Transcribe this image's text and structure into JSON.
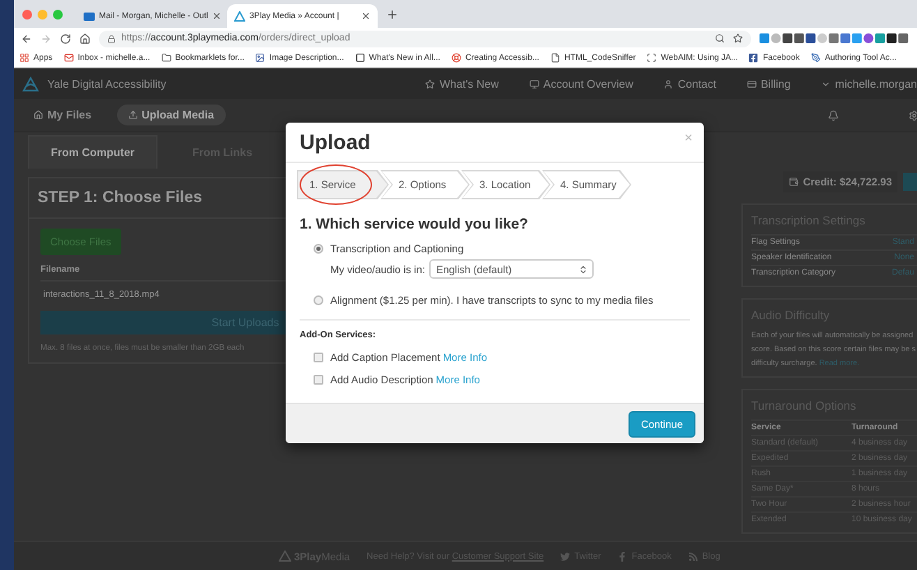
{
  "browser": {
    "tabs": [
      {
        "title": "Mail - Morgan, Michelle - Outl",
        "kind": "mail",
        "selected": false
      },
      {
        "title": "3Play Media » Account |",
        "kind": "logo",
        "selected": true
      }
    ],
    "url": {
      "scheme": "https://",
      "host": "account.3playmedia.com",
      "path": "/orders/direct_upload"
    },
    "bookmarks": [
      {
        "label": "Apps",
        "kind": "apps"
      },
      {
        "label": "Inbox - michelle.a...",
        "kind": "mail"
      },
      {
        "label": "Bookmarklets for...",
        "kind": "folder"
      },
      {
        "label": "Image Description...",
        "kind": "image"
      },
      {
        "label": "What's New in All...",
        "kind": "square"
      },
      {
        "label": "Creating Accessib...",
        "kind": "ring"
      },
      {
        "label": "HTML_CodeSniffer",
        "kind": "page"
      },
      {
        "label": "WebAIM: Using JA...",
        "kind": "scan"
      },
      {
        "label": "Facebook",
        "kind": "facebook"
      },
      {
        "label": "Authoring Tool Ac...",
        "kind": "pen"
      }
    ]
  },
  "nav": {
    "brand": "Yale Digital Accessibility",
    "links": [
      {
        "label": "What's New",
        "kind": "star"
      },
      {
        "label": "Account Overview",
        "kind": "monitor"
      },
      {
        "label": "Contact",
        "kind": "user"
      },
      {
        "label": "Billing",
        "kind": "card"
      },
      {
        "label": "michelle.morgan",
        "kind": "caret"
      }
    ]
  },
  "subnav": {
    "items": [
      {
        "label": "My Files",
        "kind": "home",
        "selected": false
      },
      {
        "label": "Upload Media",
        "kind": "upload",
        "selected": true
      }
    ]
  },
  "upload_panel": {
    "tabs": [
      {
        "label": "From Computer",
        "selected": true
      },
      {
        "label": "From Links",
        "selected": false
      }
    ],
    "heading": "STEP 1: Choose Files",
    "choose_button": "Choose Files",
    "filename_label": "Filename",
    "files": [
      "interactions_11_8_2018.mp4"
    ],
    "start_button": "Start Uploads",
    "hint": "Max. 8 files at once, files must be smaller than 2GB each"
  },
  "sidebar": {
    "credit": "Credit: $24,722.93",
    "transcription_settings": {
      "title": "Transcription Settings",
      "rows": [
        {
          "label": "Flag Settings",
          "value": "Stand"
        },
        {
          "label": "Speaker Identification",
          "value": "None"
        },
        {
          "label": "Transcription Category",
          "value": "Defau"
        }
      ]
    },
    "audio_difficulty": {
      "title": "Audio Difficulty",
      "lines": [
        "Each of your files will automatically be assigned",
        "score. Based on this score certain files may be s",
        "difficulty surcharge."
      ],
      "link": "Read more."
    },
    "turnaround": {
      "title": "Turnaround Options",
      "columns": [
        "Service",
        "Turnaround"
      ],
      "rows": [
        [
          "Standard (default)",
          "4 business day"
        ],
        [
          "Expedited",
          "2 business day"
        ],
        [
          "Rush",
          "1 business day"
        ],
        [
          "Same Day*",
          "8 hours"
        ],
        [
          "Two Hour",
          "2 business hour"
        ],
        [
          "Extended",
          "10 business day"
        ]
      ]
    }
  },
  "footer": {
    "logo": "**3Play**Media",
    "help_text": "Need Help? Visit our",
    "help_link": "Customer Support Site",
    "social": [
      {
        "label": "Twitter",
        "kind": "twitter"
      },
      {
        "label": "Facebook",
        "kind": "facebook"
      },
      {
        "label": "Blog",
        "kind": "rss"
      }
    ]
  },
  "modal": {
    "title": "Upload",
    "close": "×",
    "steps": [
      {
        "label": "1. Service",
        "selected": true,
        "circled": true
      },
      {
        "label": "2. Options",
        "selected": false,
        "circled": false
      },
      {
        "label": "3. Location",
        "selected": false,
        "circled": false
      },
      {
        "label": "4. Summary",
        "selected": false,
        "circled": false
      }
    ],
    "question": "1. Which service would you like?",
    "services": [
      {
        "label": "Transcription and Captioning",
        "selected": true
      },
      {
        "label": "Alignment ($1.25 per min). I have transcripts to sync to my media files",
        "selected": false
      }
    ],
    "language": {
      "label": "My video/audio is in:",
      "value": "English (default)"
    },
    "addons_title": "Add-On Services:",
    "addons": [
      {
        "label": "Add Caption Placement",
        "link": "More Info",
        "checked": false
      },
      {
        "label": "Add Audio Description",
        "link": "More Info",
        "checked": false
      }
    ],
    "continue": "Continue"
  }
}
